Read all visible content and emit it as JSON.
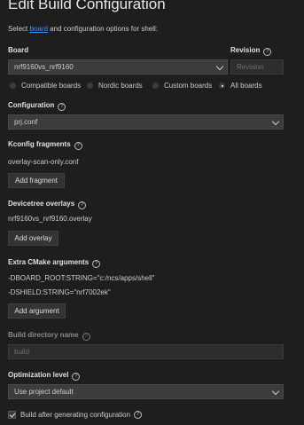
{
  "header": {
    "title": "Edit Build Configuration",
    "subtitle_pre": "Select",
    "subtitle_link": "board",
    "subtitle_post": "and configuration options for shell:"
  },
  "board": {
    "label": "Board",
    "value": "nrf9160vs_nrf9160",
    "revision_label": "Revision",
    "revision_placeholder": "Revision",
    "options": [
      {
        "label": "Compatible boards",
        "selected": false
      },
      {
        "label": "Nordic boards",
        "selected": false
      },
      {
        "label": "Custom boards",
        "selected": false
      },
      {
        "label": "All boards",
        "selected": true
      }
    ]
  },
  "configuration": {
    "label": "Configuration",
    "value": "prj.conf"
  },
  "kconfig": {
    "label": "Kconfig fragments",
    "items": [
      "overlay-scan-only.conf"
    ],
    "button": "Add fragment"
  },
  "devicetree": {
    "label": "Devicetree overlays",
    "items": [
      "nrf9160vs_nrf9160.overlay"
    ],
    "button": "Add overlay"
  },
  "cmake": {
    "label": "Extra CMake arguments",
    "items": [
      "-DBOARD_ROOT:STRING=\"c:/ncs/apps/shell\"",
      "-DSHIELD:STRING=\"nrf7002ek\""
    ],
    "button": "Add argument"
  },
  "build_dir": {
    "label": "Build directory name",
    "value": "build"
  },
  "optimization": {
    "label": "Optimization level",
    "value": "Use project default"
  },
  "build_after": {
    "label": "Build after generating configuration",
    "checked": true
  }
}
